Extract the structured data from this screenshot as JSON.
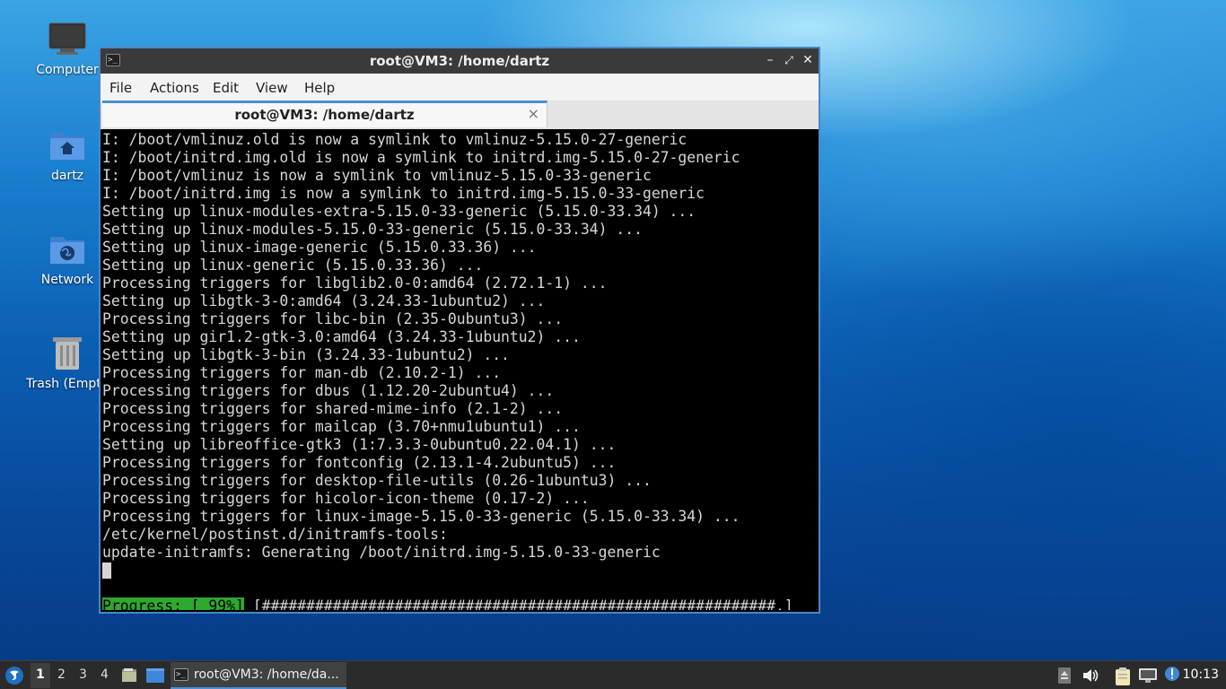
{
  "desktop": {
    "icons": [
      {
        "label": "Computer"
      },
      {
        "label": "dartz"
      },
      {
        "label": "Network"
      },
      {
        "label": "Trash (Empty)"
      }
    ]
  },
  "window": {
    "title": "root@VM3: /home/dartz",
    "menu": [
      "File",
      "Actions",
      "Edit",
      "View",
      "Help"
    ],
    "tab_label": "root@VM3: /home/dartz",
    "tab_close": "×",
    "min_glyph": "–",
    "max_glyph": "⤢",
    "close_glyph": "✕"
  },
  "terminal": {
    "lines": [
      "I: /boot/vmlinuz.old is now a symlink to vmlinuz-5.15.0-27-generic",
      "I: /boot/initrd.img.old is now a symlink to initrd.img-5.15.0-27-generic",
      "I: /boot/vmlinuz is now a symlink to vmlinuz-5.15.0-33-generic",
      "I: /boot/initrd.img is now a symlink to initrd.img-5.15.0-33-generic",
      "Setting up linux-modules-extra-5.15.0-33-generic (5.15.0-33.34) ...",
      "Setting up linux-modules-5.15.0-33-generic (5.15.0-33.34) ...",
      "Setting up linux-image-generic (5.15.0.33.36) ...",
      "Setting up linux-generic (5.15.0.33.36) ...",
      "Processing triggers for libglib2.0-0:amd64 (2.72.1-1) ...",
      "Setting up libgtk-3-0:amd64 (3.24.33-1ubuntu2) ...",
      "Processing triggers for libc-bin (2.35-0ubuntu3) ...",
      "Setting up gir1.2-gtk-3.0:amd64 (3.24.33-1ubuntu2) ...",
      "Setting up libgtk-3-bin (3.24.33-1ubuntu2) ...",
      "Processing triggers for man-db (2.10.2-1) ...",
      "Processing triggers for dbus (1.12.20-2ubuntu4) ...",
      "Processing triggers for shared-mime-info (2.1-2) ...",
      "Processing triggers for mailcap (3.70+nmu1ubuntu1) ...",
      "Setting up libreoffice-gtk3 (1:7.3.3-0ubuntu0.22.04.1) ...",
      "Processing triggers for fontconfig (2.13.1-4.2ubuntu5) ...",
      "Processing triggers for desktop-file-utils (0.26-1ubuntu3) ...",
      "Processing triggers for hicolor-icon-theme (0.17-2) ...",
      "Processing triggers for linux-image-5.15.0-33-generic (5.15.0-33.34) ...",
      "/etc/kernel/postinst.d/initramfs-tools:",
      "update-initramfs: Generating /boot/initrd.img-5.15.0-33-generic"
    ],
    "progress_label": "Progress: [ 99%]",
    "progress_bar": " [##########################################################.]",
    "progress_percent": 99
  },
  "taskbar": {
    "workspaces": [
      "1",
      "2",
      "3",
      "4"
    ],
    "active_workspace": "1",
    "task_label": "root@VM3: /home/da...",
    "clock": "10:13"
  },
  "colors": {
    "progress_green": "#2fa82f",
    "accent_blue": "#4a8fd6",
    "terminal_bg": "#000000",
    "terminal_fg": "#d6d6d6"
  }
}
